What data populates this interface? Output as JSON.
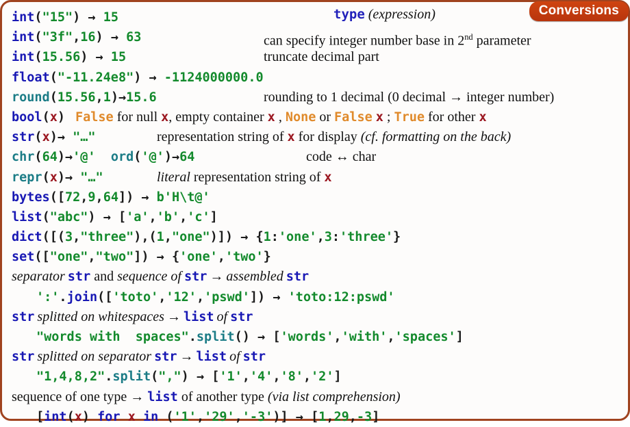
{
  "card": {
    "border_color": "#a0431f",
    "background": "#fdfcfb"
  },
  "header": {
    "type_keyword": "type",
    "type_expression": "(expression)",
    "badge_label": "Conversions",
    "badge_color": "#c23b10"
  },
  "colors": {
    "builtin_blue": "#1818b4",
    "builtin_teal": "#1b7c86",
    "string_green": "#138a2c",
    "keyword_orange": "#e08a2b",
    "variable_red": "#9b1720",
    "text_black": "#101010"
  },
  "rows": [
    {
      "id": "int-string",
      "code": "int(\"15\") → 15",
      "note": ""
    },
    {
      "id": "int-base",
      "code": "int(\"3f\",16) → 63",
      "note": "can specify integer number base in 2nd parameter",
      "note_sup": "nd"
    },
    {
      "id": "int-truncate",
      "code": "int(15.56) → 15",
      "note": "truncate decimal part"
    },
    {
      "id": "float-string",
      "code": "float(\"-11.24e8\") → -1124000000.0",
      "note": ""
    },
    {
      "id": "round",
      "code": "round(15.56,1)→15.6",
      "note": "rounding to 1 decimal (0 decimal → integer number)"
    },
    {
      "id": "bool",
      "code": "bool(x)",
      "note": "False for null x, empty container x , None or False x ; True for other x"
    },
    {
      "id": "str",
      "code": "str(x)→ \"…\"",
      "note": "representation string of x for display (cf. formatting on the back)"
    },
    {
      "id": "chr-ord",
      "code": "chr(64)→'@'  ord('@')→64",
      "note": "code ↔ char"
    },
    {
      "id": "repr",
      "code": "repr(x)→ \"…\"",
      "note": "literal representation string of x"
    },
    {
      "id": "bytes",
      "code": "bytes([72,9,64]) → b'H\\t@'",
      "note": ""
    },
    {
      "id": "list",
      "code": "list(\"abc\") → ['a','b','c']",
      "note": ""
    },
    {
      "id": "dict",
      "code": "dict([(3,\"three\"),(1,\"one\")]) → {1:'one',3:'three'}",
      "note": ""
    },
    {
      "id": "set",
      "code": "set([\"one\",\"two\"]) → {'one','two'}",
      "note": ""
    }
  ],
  "join_section": {
    "heading_parts": {
      "a": "separator",
      "b": "str",
      "c": "and",
      "d": "sequence of",
      "e": "str",
      "arrow": "→",
      "f": "assembled",
      "g": "str"
    },
    "example": "':'.join(['toto','12','pswd']) → 'toto:12:pswd'"
  },
  "split_ws_section": {
    "heading_parts": {
      "a": "str",
      "b": "splitted on whitespaces",
      "arrow": "→",
      "c": "list",
      "d": "of",
      "e": "str"
    },
    "example": "\"words with  spaces\".split() → ['words','with','spaces']"
  },
  "split_sep_section": {
    "heading_parts": {
      "a": "str",
      "b": "splitted on separator",
      "c": "str",
      "arrow": "→",
      "d": "list",
      "e": "of",
      "f": "str"
    },
    "example": "\"1,4,8,2\".split(\",\") → ['1','4','8','2']"
  },
  "comprehension_section": {
    "heading_parts": {
      "a": "sequence of one type",
      "arrow": "→",
      "b": "list",
      "c": "of another type",
      "d": "(via list comprehension)"
    },
    "example": "[int(x) for x in ('1','29','-3')] → [1,29,-3]"
  }
}
